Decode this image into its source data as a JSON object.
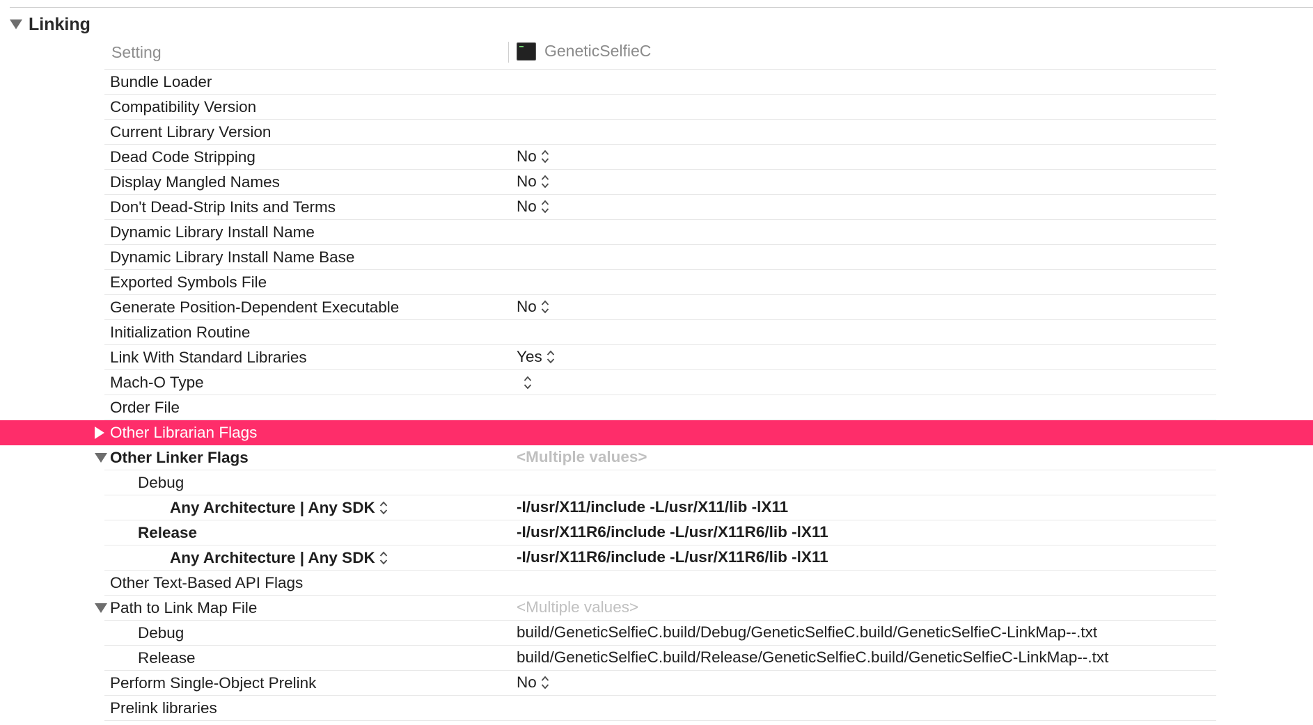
{
  "section": {
    "title": "Linking"
  },
  "header": {
    "setting_label": "Setting",
    "target_name": "GeneticSelfieC",
    "target_icon": "terminal-app-icon"
  },
  "rows": [
    {
      "label": "Bundle Loader",
      "value": ""
    },
    {
      "label": "Compatibility Version",
      "value": ""
    },
    {
      "label": "Current Library Version",
      "value": ""
    },
    {
      "label": "Dead Code Stripping",
      "value": "No"
    },
    {
      "label": "Display Mangled Names",
      "value": "No"
    },
    {
      "label": "Don't Dead-Strip Inits and Terms",
      "value": "No"
    },
    {
      "label": "Dynamic Library Install Name",
      "value": ""
    },
    {
      "label": "Dynamic Library Install Name Base",
      "value": ""
    },
    {
      "label": "Exported Symbols File",
      "value": ""
    },
    {
      "label": "Generate Position-Dependent Executable",
      "value": "No"
    },
    {
      "label": "Initialization Routine",
      "value": ""
    },
    {
      "label": "Link With Standard Libraries",
      "value": "Yes"
    },
    {
      "label": "Mach-O Type",
      "value": ""
    },
    {
      "label": "Order File",
      "value": ""
    },
    {
      "label": "Other Librarian Flags",
      "value": ""
    },
    {
      "label": "Other Linker Flags",
      "value": "<Multiple values>"
    },
    {
      "label": "Debug",
      "value": ""
    },
    {
      "label": "Any Architecture | Any SDK",
      "value": "-I/usr/X11/include -L/usr/X11/lib -lX11"
    },
    {
      "label": "Release",
      "value": "-I/usr/X11R6/include -L/usr/X11R6/lib -lX11"
    },
    {
      "label": "Any Architecture | Any SDK",
      "value": "-I/usr/X11R6/include -L/usr/X11R6/lib -lX11"
    },
    {
      "label": "Other Text-Based API Flags",
      "value": ""
    },
    {
      "label": "Path to Link Map File",
      "value": "<Multiple values>"
    },
    {
      "label": "Debug",
      "value": "build/GeneticSelfieC.build/Debug/GeneticSelfieC.build/GeneticSelfieC-LinkMap--.txt"
    },
    {
      "label": "Release",
      "value": "build/GeneticSelfieC.build/Release/GeneticSelfieC.build/GeneticSelfieC-LinkMap--.txt"
    },
    {
      "label": "Perform Single-Object Prelink",
      "value": "No"
    },
    {
      "label": "Prelink libraries",
      "value": ""
    }
  ],
  "colors": {
    "selection": "#fe2d6a",
    "muted_text": "#c0c0c0"
  }
}
